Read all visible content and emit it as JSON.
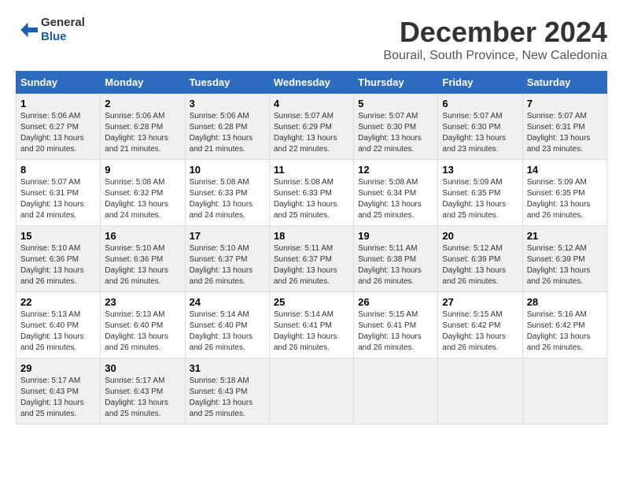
{
  "logo": {
    "text_general": "General",
    "text_blue": "Blue"
  },
  "title": "December 2024",
  "location": "Bourail, South Province, New Caledonia",
  "days_of_week": [
    "Sunday",
    "Monday",
    "Tuesday",
    "Wednesday",
    "Thursday",
    "Friday",
    "Saturday"
  ],
  "weeks": [
    [
      {
        "day": "1",
        "sunrise": "5:06 AM",
        "sunset": "6:27 PM",
        "daylight": "13 hours and 20 minutes."
      },
      {
        "day": "2",
        "sunrise": "5:06 AM",
        "sunset": "6:28 PM",
        "daylight": "13 hours and 21 minutes."
      },
      {
        "day": "3",
        "sunrise": "5:06 AM",
        "sunset": "6:28 PM",
        "daylight": "13 hours and 21 minutes."
      },
      {
        "day": "4",
        "sunrise": "5:07 AM",
        "sunset": "6:29 PM",
        "daylight": "13 hours and 22 minutes."
      },
      {
        "day": "5",
        "sunrise": "5:07 AM",
        "sunset": "6:30 PM",
        "daylight": "13 hours and 22 minutes."
      },
      {
        "day": "6",
        "sunrise": "5:07 AM",
        "sunset": "6:30 PM",
        "daylight": "13 hours and 23 minutes."
      },
      {
        "day": "7",
        "sunrise": "5:07 AM",
        "sunset": "6:31 PM",
        "daylight": "13 hours and 23 minutes."
      }
    ],
    [
      {
        "day": "8",
        "sunrise": "5:07 AM",
        "sunset": "6:31 PM",
        "daylight": "13 hours and 24 minutes."
      },
      {
        "day": "9",
        "sunrise": "5:08 AM",
        "sunset": "6:32 PM",
        "daylight": "13 hours and 24 minutes."
      },
      {
        "day": "10",
        "sunrise": "5:08 AM",
        "sunset": "6:33 PM",
        "daylight": "13 hours and 24 minutes."
      },
      {
        "day": "11",
        "sunrise": "5:08 AM",
        "sunset": "6:33 PM",
        "daylight": "13 hours and 25 minutes."
      },
      {
        "day": "12",
        "sunrise": "5:08 AM",
        "sunset": "6:34 PM",
        "daylight": "13 hours and 25 minutes."
      },
      {
        "day": "13",
        "sunrise": "5:09 AM",
        "sunset": "6:35 PM",
        "daylight": "13 hours and 25 minutes."
      },
      {
        "day": "14",
        "sunrise": "5:09 AM",
        "sunset": "6:35 PM",
        "daylight": "13 hours and 26 minutes."
      }
    ],
    [
      {
        "day": "15",
        "sunrise": "5:10 AM",
        "sunset": "6:36 PM",
        "daylight": "13 hours and 26 minutes."
      },
      {
        "day": "16",
        "sunrise": "5:10 AM",
        "sunset": "6:36 PM",
        "daylight": "13 hours and 26 minutes."
      },
      {
        "day": "17",
        "sunrise": "5:10 AM",
        "sunset": "6:37 PM",
        "daylight": "13 hours and 26 minutes."
      },
      {
        "day": "18",
        "sunrise": "5:11 AM",
        "sunset": "6:37 PM",
        "daylight": "13 hours and 26 minutes."
      },
      {
        "day": "19",
        "sunrise": "5:11 AM",
        "sunset": "6:38 PM",
        "daylight": "13 hours and 26 minutes."
      },
      {
        "day": "20",
        "sunrise": "5:12 AM",
        "sunset": "6:39 PM",
        "daylight": "13 hours and 26 minutes."
      },
      {
        "day": "21",
        "sunrise": "5:12 AM",
        "sunset": "6:39 PM",
        "daylight": "13 hours and 26 minutes."
      }
    ],
    [
      {
        "day": "22",
        "sunrise": "5:13 AM",
        "sunset": "6:40 PM",
        "daylight": "13 hours and 26 minutes."
      },
      {
        "day": "23",
        "sunrise": "5:13 AM",
        "sunset": "6:40 PM",
        "daylight": "13 hours and 26 minutes."
      },
      {
        "day": "24",
        "sunrise": "5:14 AM",
        "sunset": "6:40 PM",
        "daylight": "13 hours and 26 minutes."
      },
      {
        "day": "25",
        "sunrise": "5:14 AM",
        "sunset": "6:41 PM",
        "daylight": "13 hours and 26 minutes."
      },
      {
        "day": "26",
        "sunrise": "5:15 AM",
        "sunset": "6:41 PM",
        "daylight": "13 hours and 26 minutes."
      },
      {
        "day": "27",
        "sunrise": "5:15 AM",
        "sunset": "6:42 PM",
        "daylight": "13 hours and 26 minutes."
      },
      {
        "day": "28",
        "sunrise": "5:16 AM",
        "sunset": "6:42 PM",
        "daylight": "13 hours and 26 minutes."
      }
    ],
    [
      {
        "day": "29",
        "sunrise": "5:17 AM",
        "sunset": "6:43 PM",
        "daylight": "13 hours and 25 minutes."
      },
      {
        "day": "30",
        "sunrise": "5:17 AM",
        "sunset": "6:43 PM",
        "daylight": "13 hours and 25 minutes."
      },
      {
        "day": "31",
        "sunrise": "5:18 AM",
        "sunset": "6:43 PM",
        "daylight": "13 hours and 25 minutes."
      },
      null,
      null,
      null,
      null
    ]
  ]
}
